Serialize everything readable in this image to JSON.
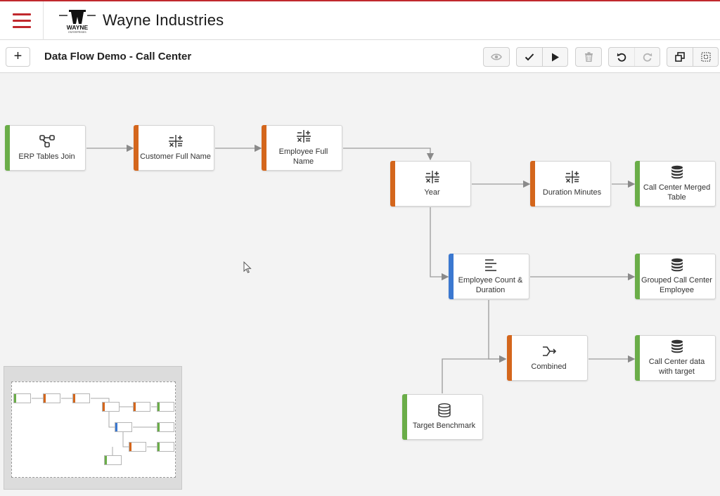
{
  "app": {
    "company_name": "Wayne Industries",
    "logo_text": "WAYNE",
    "logo_subtext": "ENTERPRISES"
  },
  "toolbar": {
    "flow_title": "Data Flow Demo - Call Center",
    "add_label": "+"
  },
  "colors": {
    "accent_red": "#c0282d",
    "source_green": "#6aad48",
    "transform_orange": "#d4661c",
    "aggregate_blue": "#3b78d0"
  },
  "nodes": [
    {
      "id": "erp",
      "label": "ERP Tables Join",
      "icon": "join-icon",
      "type": "source"
    },
    {
      "id": "cust",
      "label": "Customer Full Name",
      "icon": "formula-icon",
      "type": "transform"
    },
    {
      "id": "emp",
      "label": "Employee Full Name",
      "icon": "formula-icon",
      "type": "transform"
    },
    {
      "id": "year",
      "label": "Year",
      "icon": "formula-icon",
      "type": "transform"
    },
    {
      "id": "dur",
      "label": "Duration Minutes",
      "icon": "formula-icon",
      "type": "transform"
    },
    {
      "id": "merged",
      "label": "Call Center Merged Table",
      "icon": "database-icon",
      "type": "source"
    },
    {
      "id": "count",
      "label": "Employee Count & Duration",
      "icon": "aggregate-icon",
      "type": "aggregate"
    },
    {
      "id": "grouped",
      "label": "Grouped Call Center Employee",
      "icon": "database-icon",
      "type": "source"
    },
    {
      "id": "combined",
      "label": "Combined",
      "icon": "merge-icon",
      "type": "transform"
    },
    {
      "id": "target",
      "label": "Call Center data with target",
      "icon": "database-icon",
      "type": "source"
    },
    {
      "id": "bench",
      "label": "Target Benchmark",
      "icon": "database-icon",
      "type": "source"
    }
  ]
}
